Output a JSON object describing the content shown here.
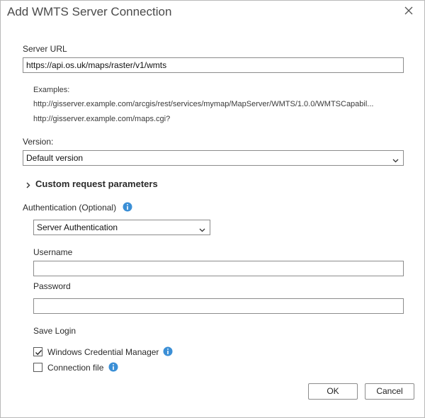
{
  "dialog": {
    "title": "Add WMTS Server Connection"
  },
  "server_url": {
    "label": "Server URL",
    "value": "https://api.os.uk/maps/raster/v1/wmts",
    "examples_label": "Examples:",
    "example_1": "http://gisserver.example.com/arcgis/rest/services/mymap/MapServer/WMTS/1.0.0/WMTSCapabil...",
    "example_2": "http://gisserver.example.com/maps.cgi?"
  },
  "version": {
    "label": "Version:",
    "selected": "Default version"
  },
  "custom_params": {
    "label": "Custom request parameters"
  },
  "authentication": {
    "label": "Authentication (Optional)",
    "type_selected": "Server Authentication",
    "username_label": "Username",
    "username_value": "",
    "password_label": "Password",
    "password_value": "",
    "save_login_label": "Save Login",
    "windows_cred_label": "Windows Credential Manager",
    "windows_cred_checked": true,
    "connection_file_label": "Connection file",
    "connection_file_checked": false
  },
  "buttons": {
    "ok": "OK",
    "cancel": "Cancel"
  },
  "colors": {
    "info_icon": "#3b8fd6",
    "border": "#8c8c8c"
  }
}
